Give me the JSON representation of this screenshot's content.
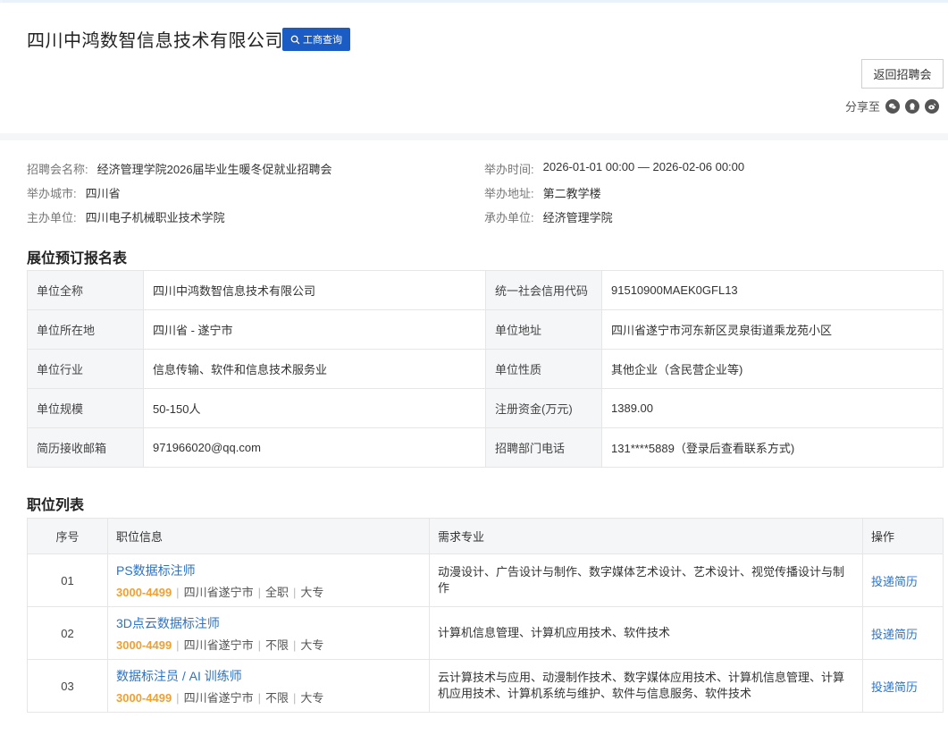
{
  "header": {
    "company_name": "四川中鸿数智信息技术有限公司",
    "gs_button": "工商查询",
    "back_button": "返回招聘会",
    "share_label": "分享至"
  },
  "fair": {
    "name_label": "招聘会名称:",
    "name": "经济管理学院2026届毕业生暖冬促就业招聘会",
    "time_label": "举办时间:",
    "time": "2026-01-01 00:00 — 2026-02-06 00:00",
    "city_label": "举办城市:",
    "city": "四川省",
    "address_label": "举办地址:",
    "address": "第二教学楼",
    "host_label": "主办单位:",
    "host": "四川电子机械职业技术学院",
    "organizer_label": "承办单位:",
    "organizer": "经济管理学院"
  },
  "booking": {
    "title": "展位预订报名表",
    "rows": [
      [
        {
          "label": "单位全称",
          "value": "四川中鸿数智信息技术有限公司"
        },
        {
          "label": "统一社会信用代码",
          "value": "91510900MAEK0GFL13"
        }
      ],
      [
        {
          "label": "单位所在地",
          "value": "四川省 - 遂宁市"
        },
        {
          "label": "单位地址",
          "value": "四川省遂宁市河东新区灵泉街道乘龙苑小区"
        }
      ],
      [
        {
          "label": "单位行业",
          "value": "信息传输、软件和信息技术服务业"
        },
        {
          "label": "单位性质",
          "value": "其他企业（含民营企业等)"
        }
      ],
      [
        {
          "label": "单位规模",
          "value": "50-150人"
        },
        {
          "label": "注册资金(万元)",
          "value": "1389.00"
        }
      ],
      [
        {
          "label": "简历接收邮箱",
          "value": "971966020@qq.com"
        },
        {
          "label": "招聘部门电话",
          "value": "131****5889（登录后查看联系方式)"
        }
      ]
    ]
  },
  "positions": {
    "title": "职位列表",
    "headers": {
      "no": "序号",
      "info": "职位信息",
      "major": "需求专业",
      "op": "操作"
    },
    "apply_label": "投递简历",
    "items": [
      {
        "no": "01",
        "title": "PS数据标注师",
        "salary": "3000-4499",
        "location": "四川省遂宁市",
        "type": "全职",
        "edu": "大专",
        "major": "动漫设计、广告设计与制作、数字媒体艺术设计、艺术设计、视觉传播设计与制作"
      },
      {
        "no": "02",
        "title": "3D点云数据标注师",
        "salary": "3000-4499",
        "location": "四川省遂宁市",
        "type": "不限",
        "edu": "大专",
        "major": "计算机信息管理、计算机应用技术、软件技术"
      },
      {
        "no": "03",
        "title": "数据标注员 / AI 训练师",
        "salary": "3000-4499",
        "location": "四川省遂宁市",
        "type": "不限",
        "edu": "大专",
        "major": "云计算技术与应用、动漫制作技术、数字媒体应用技术、计算机信息管理、计算机应用技术、计算机系统与维护、软件与信息服务、软件技术"
      }
    ]
  },
  "colors": {
    "primary": "#1a5bc4",
    "link": "#2b73c6",
    "salary": "#f0a030"
  }
}
